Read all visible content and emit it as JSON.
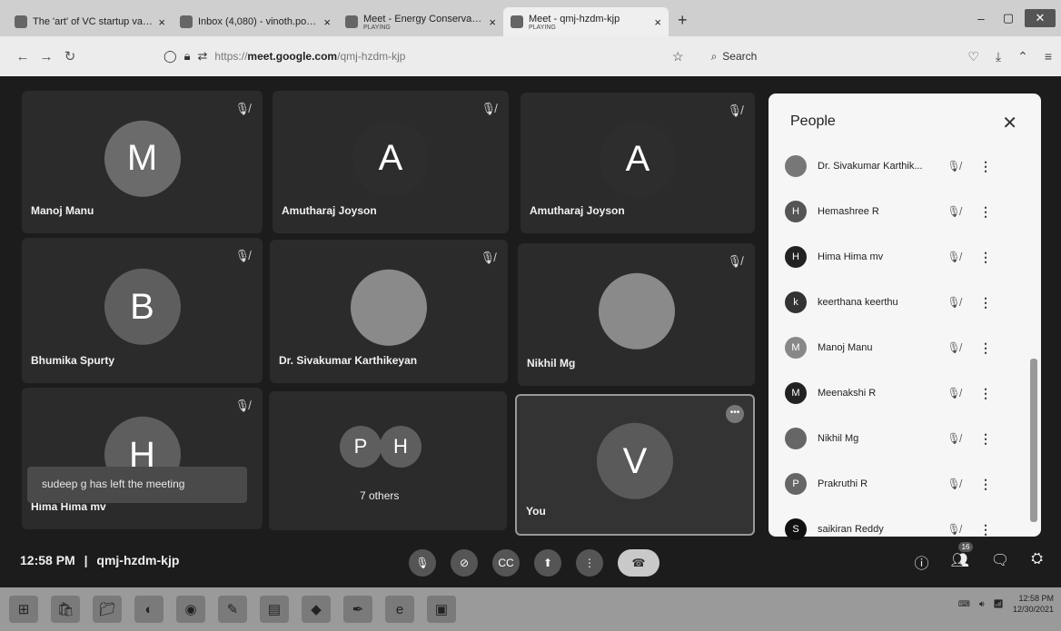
{
  "browser": {
    "tabs": [
      {
        "title": "The 'art' of VC startup valuatio",
        "sub": "",
        "active": false
      },
      {
        "title": "Inbox (4,080) - vinoth.pongu@",
        "sub": "",
        "active": false
      },
      {
        "title": "Meet - Energy Conservation -",
        "sub": "PLAYING",
        "active": false
      },
      {
        "title": "Meet - qmj-hzdm-kjp",
        "sub": "PLAYING",
        "active": true
      }
    ],
    "new_tab": "+",
    "url_prefix": "https://",
    "url_domain": "meet.google.com",
    "url_path": "/qmj-hzdm-kjp",
    "search_label": "Search"
  },
  "tiles": [
    {
      "name": "Manoj Manu",
      "initial": "M",
      "avatar_color": "#6b6b6b"
    },
    {
      "name": "Amutharaj Joyson",
      "initial": "A",
      "avatar_color": "#2d2d2d"
    },
    {
      "name": "Amutharaj Joyson",
      "initial": "A",
      "avatar_color": "#2d2d2d"
    },
    {
      "name": "Bhumika Spurty",
      "initial": "B",
      "avatar_color": "#5e5e5e"
    },
    {
      "name": "Dr. Sivakumar Karthikeyan",
      "initial": "",
      "avatar_color": "#8a8a8a"
    },
    {
      "name": "Nikhil Mg",
      "initial": "",
      "avatar_color": "#8a8a8a"
    },
    {
      "name": "Hima Hima mv",
      "initial": "H",
      "avatar_color": "#5e5e5e"
    },
    {
      "name": "7 others",
      "initial": "",
      "avatar_color": "#5e5e5e"
    },
    {
      "name": "You",
      "initial": "V",
      "avatar_color": "#5a5a5a"
    }
  ],
  "others_initials": [
    "P",
    "H"
  ],
  "toast": "sudeep g has left the meeting",
  "people_panel": {
    "title": "People",
    "participants": [
      {
        "name": "Dr. Sivakumar Karthik...",
        "initial": ""
      },
      {
        "name": "Hemashree R",
        "initial": "H"
      },
      {
        "name": "Hima Hima mv",
        "initial": "H"
      },
      {
        "name": "keerthana keerthu",
        "initial": "k"
      },
      {
        "name": "Manoj Manu",
        "initial": "M"
      },
      {
        "name": "Meenakshi R",
        "initial": "M"
      },
      {
        "name": "Nikhil Mg",
        "initial": ""
      },
      {
        "name": "Prakruthi R",
        "initial": "P"
      },
      {
        "name": "saikiran Reddy",
        "initial": "S"
      }
    ]
  },
  "meeting": {
    "time": "12:58 PM",
    "code": "qmj-hzdm-kjp",
    "participant_count": "16"
  },
  "taskbar": {
    "clock_time": "12:58 PM",
    "clock_date": "12/30/2021"
  }
}
